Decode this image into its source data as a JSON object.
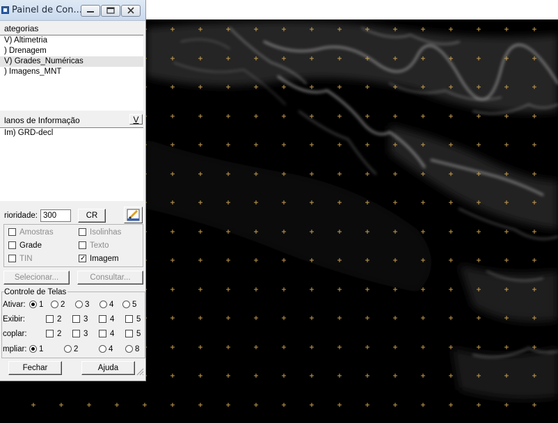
{
  "window": {
    "title": "Painel de Con..."
  },
  "categories": {
    "header": "ategorias",
    "items": [
      "V) Altimetria",
      ") Drenagem",
      "V) Grades_Numéricas",
      ") Imagens_MNT"
    ],
    "selected_index": 2
  },
  "info_planes": {
    "header": "lanos de Informação",
    "v_button": "V",
    "items": [
      "Im) GRD-decl"
    ]
  },
  "priority": {
    "label": "rioridade:",
    "value": "300",
    "cr_button": "CR"
  },
  "representations": [
    {
      "label": "Amostras",
      "checked": false,
      "enabled": false
    },
    {
      "label": "Isolinhas",
      "checked": false,
      "enabled": false
    },
    {
      "label": "Grade",
      "checked": false,
      "enabled": true
    },
    {
      "label": "Texto",
      "checked": false,
      "enabled": false
    },
    {
      "label": "TIN",
      "checked": false,
      "enabled": false
    },
    {
      "label": "Imagem",
      "checked": true,
      "enabled": true
    }
  ],
  "actions": {
    "select": "Selecionar...",
    "query": "Consultar..."
  },
  "screen_control": {
    "title": "Controle de Telas",
    "activate": {
      "label": "Ativar:",
      "options": [
        "1",
        "2",
        "3",
        "4",
        "5"
      ],
      "selected": "1"
    },
    "display": {
      "label": "Exibir:",
      "options": [
        "2",
        "3",
        "4",
        "5"
      ]
    },
    "couple": {
      "label": "coplar:",
      "options": [
        "2",
        "3",
        "4",
        "5"
      ]
    },
    "zoom": {
      "label": "mpliar:",
      "options": [
        "1",
        "2",
        "4",
        "8"
      ],
      "selected": "1"
    }
  },
  "footer": {
    "close": "Fechar",
    "help": "Ajuda"
  },
  "map_style": {
    "background": "#000000",
    "grid_color": "#c8a050",
    "relief_color": "#d8d8d8"
  }
}
